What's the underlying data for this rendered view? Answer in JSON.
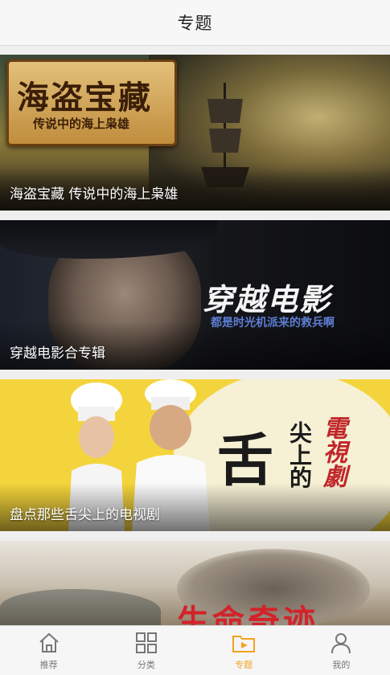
{
  "header": {
    "title": "专题"
  },
  "cards": [
    {
      "caption": "海盗宝藏 传说中的海上枭雄",
      "art_title": "海盗宝藏",
      "art_subtitle": "传说中的海上枭雄"
    },
    {
      "caption": "穿越电影合专辑",
      "art_title": "穿越电影",
      "art_subtitle": "都是时光机派来的救兵啊"
    },
    {
      "caption": "盘点那些舌尖上的电视剧",
      "art_char": "舌",
      "art_col1": "尖上的",
      "art_col2": "電視劇"
    },
    {
      "caption": "",
      "art_title": "生命奇迹"
    }
  ],
  "tabbar": {
    "items": [
      {
        "label": "推荐",
        "icon": "home-icon"
      },
      {
        "label": "分类",
        "icon": "grid-icon"
      },
      {
        "label": "专题",
        "icon": "play-folder-icon",
        "active": true
      },
      {
        "label": "我的",
        "icon": "user-icon"
      }
    ]
  },
  "colors": {
    "accent": "#f3a321",
    "header_bg": "#f7f7f7"
  }
}
